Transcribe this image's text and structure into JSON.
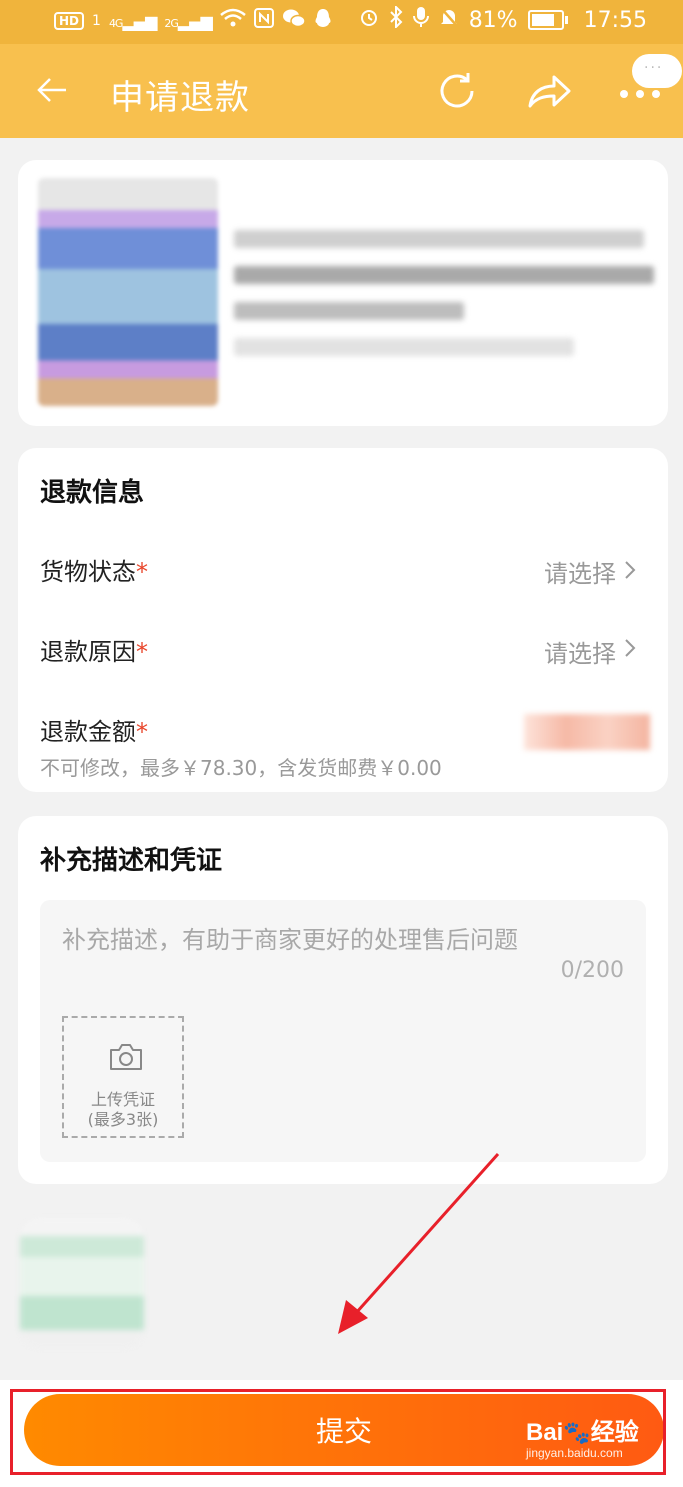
{
  "status_bar": {
    "hd": "HD",
    "sim1": "1",
    "net1": "4G",
    "net2": "2G",
    "battery_pct": "81%",
    "time": "17:55"
  },
  "header": {
    "title": "申请退款",
    "icons": [
      "back-arrow-icon",
      "refresh-icon",
      "share-icon",
      "more-icon"
    ],
    "bubble": "···"
  },
  "refund_info": {
    "title": "退款信息",
    "rows": [
      {
        "label": "货物状态",
        "required": "*",
        "value": "请选择"
      },
      {
        "label": "退款原因",
        "required": "*",
        "value": "请选择"
      },
      {
        "label": "退款金额",
        "required": "*"
      }
    ],
    "amount_hint": "不可修改，最多￥78.30，含发货邮费￥0.00"
  },
  "description": {
    "title": "补充描述和凭证",
    "placeholder": "补充描述，有助于商家更好的处理售后问题",
    "counter": "0/200",
    "upload_label_1": "上传凭证",
    "upload_label_2": "(最多3张)"
  },
  "footer": {
    "submit_label": "提交"
  },
  "watermark": {
    "brand": "Bai",
    "brand_cn": "经验",
    "url": "jingyan.baidu.com"
  },
  "colors": {
    "header": "#f8c04e",
    "accent": "#ff6a0a",
    "required": "#e8462b",
    "annotation": "#e8202a"
  }
}
